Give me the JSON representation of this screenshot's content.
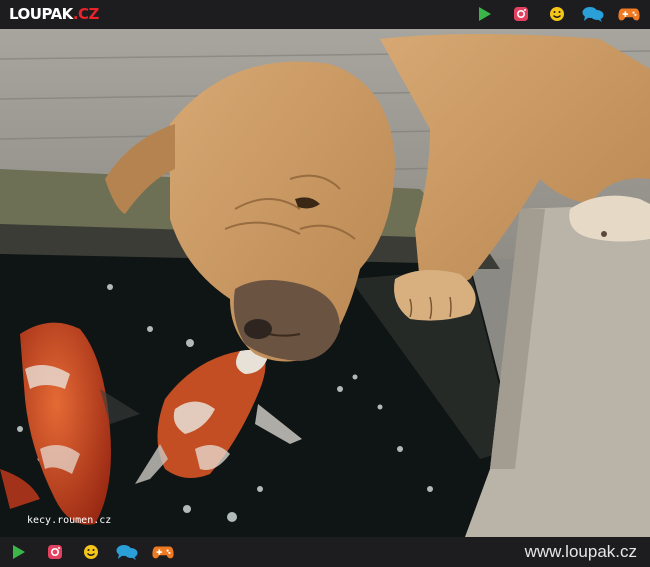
{
  "header": {
    "logo_main": "LOUPAK",
    "logo_accent": ".CZ"
  },
  "nav_icons": [
    "play-icon",
    "instagram-icon",
    "smiley-icon",
    "chat-icon",
    "gamepad-icon"
  ],
  "colors": {
    "bar_background": "#1d1d1f",
    "logo_accent": "#e8232a",
    "play": "#3bb54a",
    "instagram": "#e4405f",
    "smiley": "#f5c518",
    "chat": "#2a9fd8",
    "gamepad": "#f07a22"
  },
  "photo": {
    "caption": "kecy.roumen.cz"
  },
  "footer": {
    "url": "www.loupak.cz"
  }
}
